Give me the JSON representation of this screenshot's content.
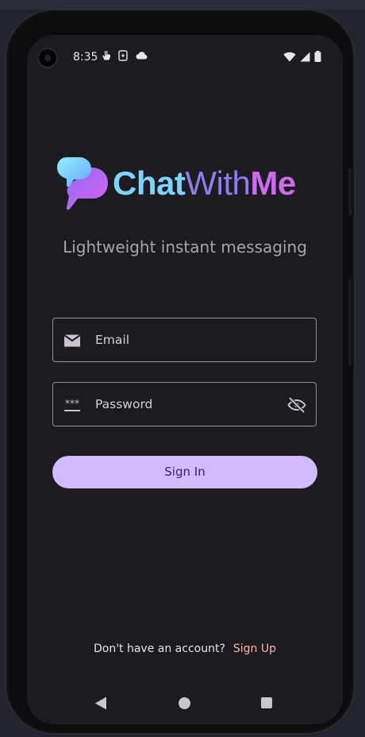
{
  "status_bar": {
    "time": "8:35",
    "left_icons": [
      "touch-icon",
      "sim-icon",
      "cloud-icon"
    ],
    "right_icons": [
      "wifi-icon",
      "signal-icon",
      "battery-icon"
    ]
  },
  "logo": {
    "icon": "chat-bubbles-icon",
    "part1": "Chat",
    "part2": "With",
    "part3": "Me"
  },
  "tagline": "Lightweight instant messaging",
  "form": {
    "email": {
      "placeholder": "Email",
      "icon": "mail-icon"
    },
    "password": {
      "placeholder": "Password",
      "icon": "password-icon",
      "trailing_icon": "visibility-off-icon"
    },
    "signin_label": "Sign In"
  },
  "footer": {
    "question": "Don't have an account?",
    "signup_label": "Sign Up"
  },
  "nav_bar": [
    "back-icon",
    "home-icon",
    "recents-icon"
  ],
  "colors": {
    "background": "#1c1b20",
    "primary_button": "#d0bcfe",
    "button_text": "#381e72",
    "link": "#ffb4ab",
    "outline": "#938f99"
  }
}
